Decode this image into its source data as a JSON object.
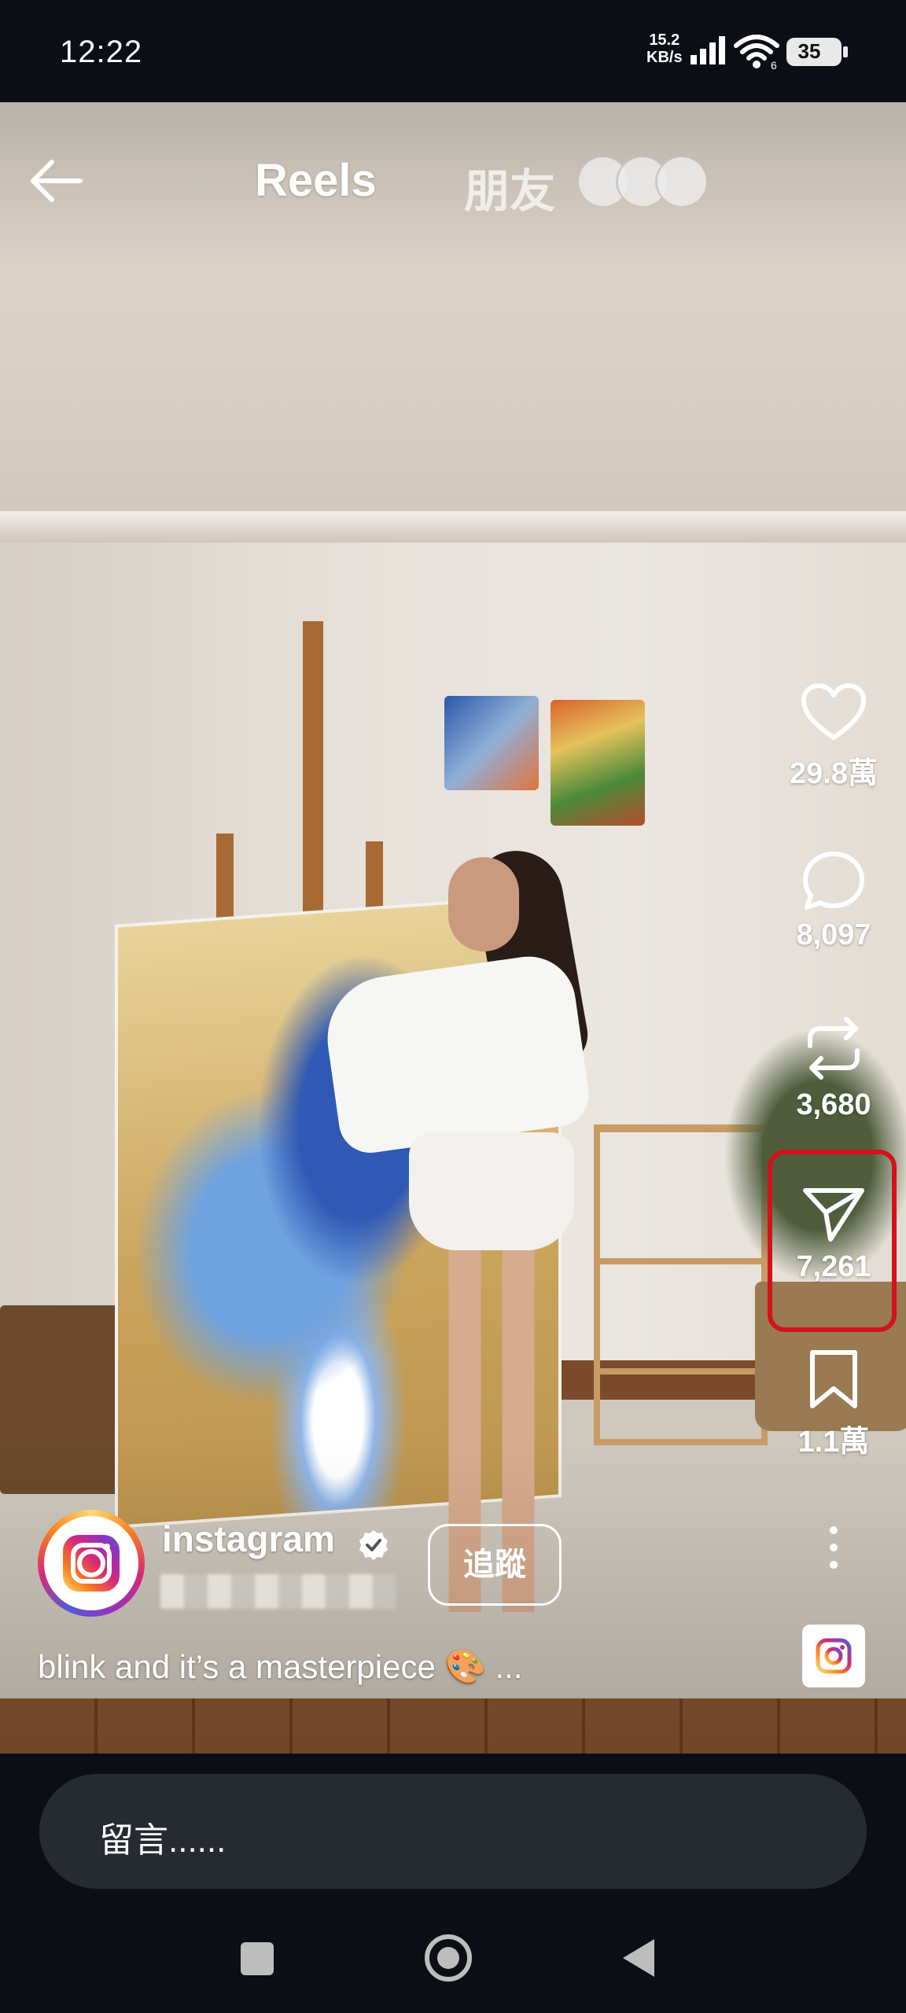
{
  "status_bar": {
    "time": "12:22",
    "net_speed_value": "15.2",
    "net_speed_unit": "KB/s",
    "battery": "35",
    "wifi_label": "6"
  },
  "top_bar": {
    "tab_reels": "Reels",
    "tab_friends": "朋友"
  },
  "actions": {
    "like_count": "29.8萬",
    "comment_count": "8,097",
    "repost_count": "3,680",
    "share_count": "7,261",
    "save_count": "1.1萬"
  },
  "author": {
    "username": "instagram",
    "follow_label": "追蹤"
  },
  "caption": "blink and it’s a masterpiece 🎨 ...",
  "comment_bar": {
    "placeholder": "留言......"
  },
  "colors": {
    "highlight": "#d3121b",
    "background": "#0b0e14"
  }
}
